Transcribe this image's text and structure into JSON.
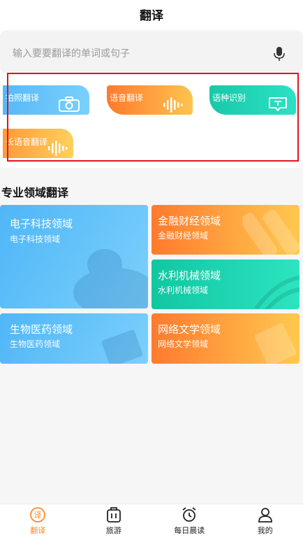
{
  "header": {
    "title": "翻译"
  },
  "search": {
    "placeholder": "输入要要翻译的单词或句子",
    "icon": "microphone-icon"
  },
  "tools": [
    {
      "label": "拍照翻译",
      "icon": "camera-icon"
    },
    {
      "label": "语音翻译",
      "icon": "audio-wave-icon"
    },
    {
      "label": "语种识别",
      "icon": "text-bubble-icon"
    },
    {
      "label": "长语音翻译",
      "icon": "audio-wave-icon"
    }
  ],
  "section": {
    "title": "专业领域翻译"
  },
  "domains": [
    {
      "name": "电子科技领域",
      "sub": "电子科技领域"
    },
    {
      "name": "金融财经领域",
      "sub": "金融财经领域"
    },
    {
      "name": "水利机械领域",
      "sub": "水利机械领域"
    },
    {
      "name": "生物医药领域",
      "sub": "生物医药领域"
    },
    {
      "name": "网络文学领域",
      "sub": "网络文学领域"
    }
  ],
  "tabs": [
    {
      "label": "翻译",
      "icon": "translate-icon"
    },
    {
      "label": "旅游",
      "icon": "suitcase-icon"
    },
    {
      "label": "每日晨读",
      "icon": "alarm-clock-icon"
    },
    {
      "label": "我的",
      "icon": "user-icon"
    }
  ],
  "colors": {
    "accent": "#ff8a2b",
    "blue": "#58b8f8",
    "green": "#19c8a8",
    "highlight": "#e0131c"
  }
}
